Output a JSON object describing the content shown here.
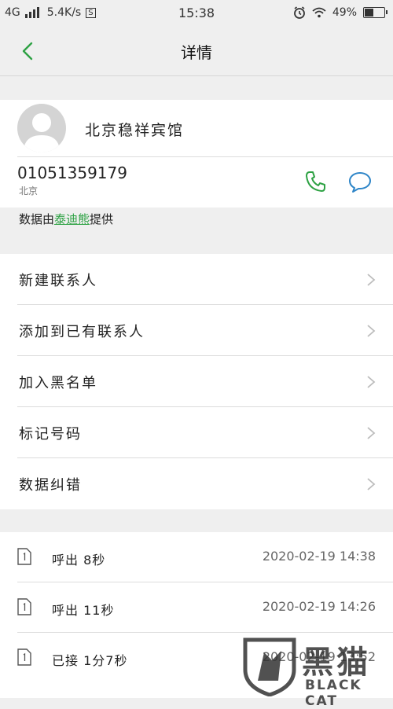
{
  "status_bar": {
    "network": "4G",
    "speed": "5.4K/s",
    "speed_badge": "S",
    "time": "15:38",
    "battery": "49%",
    "battery_level": 0.49,
    "icons": [
      "signal-icon",
      "alarm-icon",
      "wifi-icon",
      "battery-icon"
    ]
  },
  "header": {
    "title": "详情",
    "back_icon": "back-arrow-icon"
  },
  "contact": {
    "name": "北京稳祥宾馆",
    "phone": "01051359179",
    "location": "北京",
    "call_icon": "phone-icon",
    "message_icon": "message-icon",
    "accent_color": "#2ea244",
    "message_color": "#2f86c8"
  },
  "provider": {
    "prefix": "数据由",
    "link": "泰迪熊",
    "suffix": "提供"
  },
  "menu": [
    {
      "label": "新建联系人"
    },
    {
      "label": "添加到已有联系人"
    },
    {
      "label": "加入黑名单"
    },
    {
      "label": "标记号码"
    },
    {
      "label": "数据纠错"
    }
  ],
  "calls": [
    {
      "type": "呼出  8秒",
      "time": "2020-02-19  14:38"
    },
    {
      "type": "呼出  11秒",
      "time": "2020-02-19  14:26"
    },
    {
      "type": "已接  1分7秒",
      "time": "2020-02-19  13:52"
    }
  ],
  "watermark": {
    "text_cn": "黑猫",
    "text_en": "BLACK CAT"
  }
}
